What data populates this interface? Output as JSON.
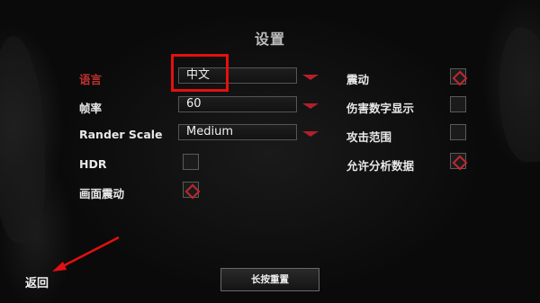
{
  "title": "设置",
  "left_settings": [
    {
      "label": "语言",
      "control": "dropdown",
      "value": "中文",
      "highlighted": true
    },
    {
      "label": "帧率",
      "control": "dropdown",
      "value": "60",
      "highlighted": false
    },
    {
      "label": "Rander Scale",
      "control": "dropdown",
      "value": "Medium",
      "highlighted": false
    },
    {
      "label": "HDR",
      "control": "checkbox",
      "checked": false
    },
    {
      "label": "画面震动",
      "control": "checkbox",
      "checked": true
    }
  ],
  "right_settings": [
    {
      "label": "震动",
      "control": "checkbox",
      "checked": true
    },
    {
      "label": "伤害数字显示",
      "control": "checkbox",
      "checked": false
    },
    {
      "label": "攻击范围",
      "control": "checkbox",
      "checked": false
    },
    {
      "label": "允许分析数据",
      "control": "checkbox",
      "checked": true
    }
  ],
  "buttons": {
    "reset": "长按重置",
    "back": "返回"
  },
  "colors": {
    "accent_red": "#c0322f",
    "annotation_red": "#e41010",
    "background": "#0d0d0d"
  }
}
